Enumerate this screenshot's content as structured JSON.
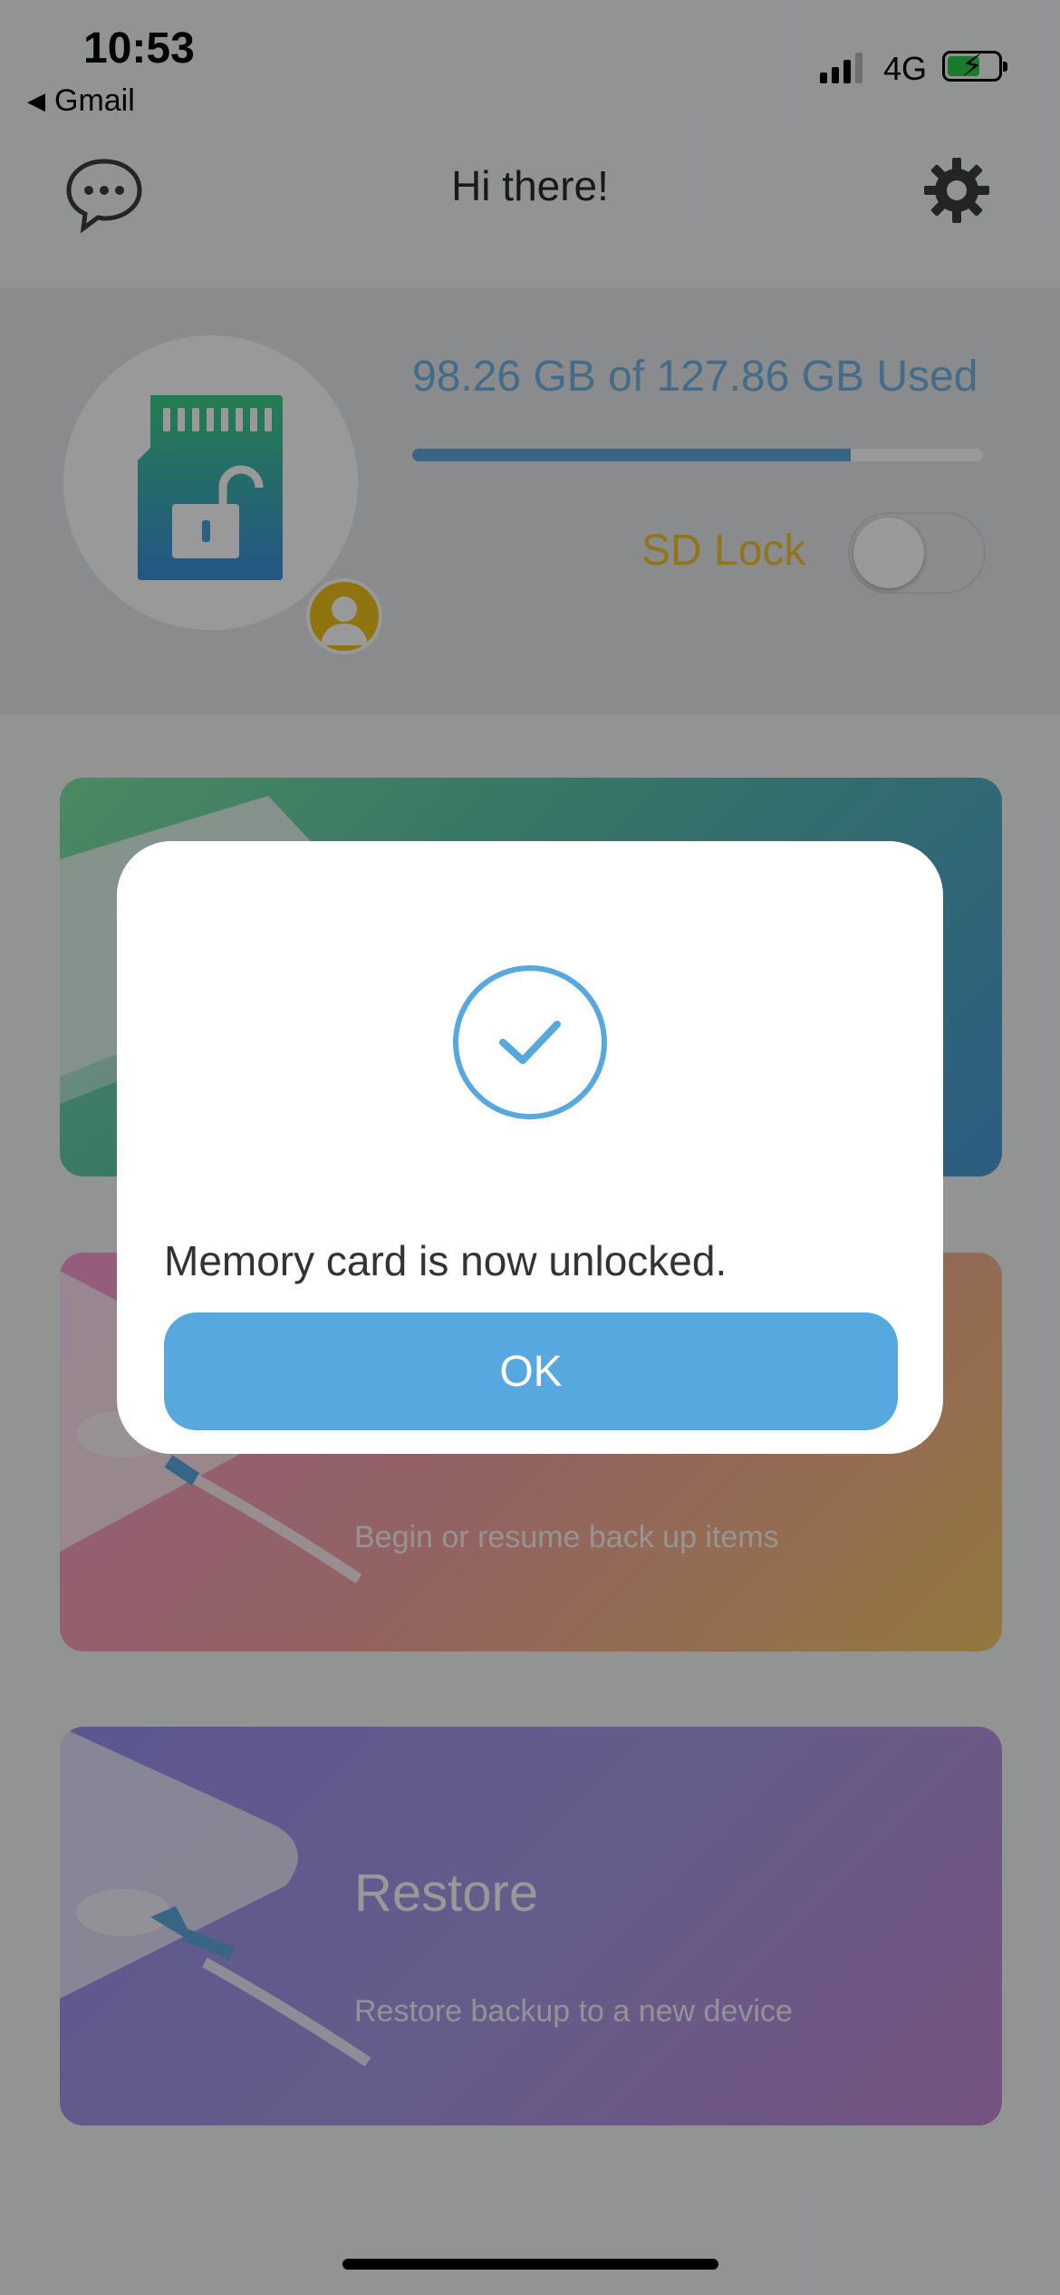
{
  "status_bar": {
    "time": "10:53",
    "back_app": "Gmail",
    "network": "4G",
    "battery_level": 0.58
  },
  "header": {
    "greeting": "Hi there!"
  },
  "storage": {
    "used_text": "98.26 GB of 127.86 GB Used",
    "used_fraction": 0.7685,
    "sd_lock_label": "SD Lock",
    "sd_lock_on": false
  },
  "cards": [
    {
      "title": "",
      "subtitle": ""
    },
    {
      "title": "",
      "subtitle": "Begin or resume back up items"
    },
    {
      "title": "Restore",
      "subtitle": "Restore backup to a new device"
    }
  ],
  "dialog": {
    "message": "Memory card is now unlocked.",
    "ok_label": "OK"
  },
  "colors": {
    "accent": "#56a8df",
    "lock_yellow": "#f2c230",
    "battery_green": "#2fcc48"
  },
  "icons": [
    "chat-bubble-icon",
    "gear-icon",
    "sd-card-unlocked-icon",
    "user-avatar-icon",
    "checkmark-circle-icon"
  ]
}
